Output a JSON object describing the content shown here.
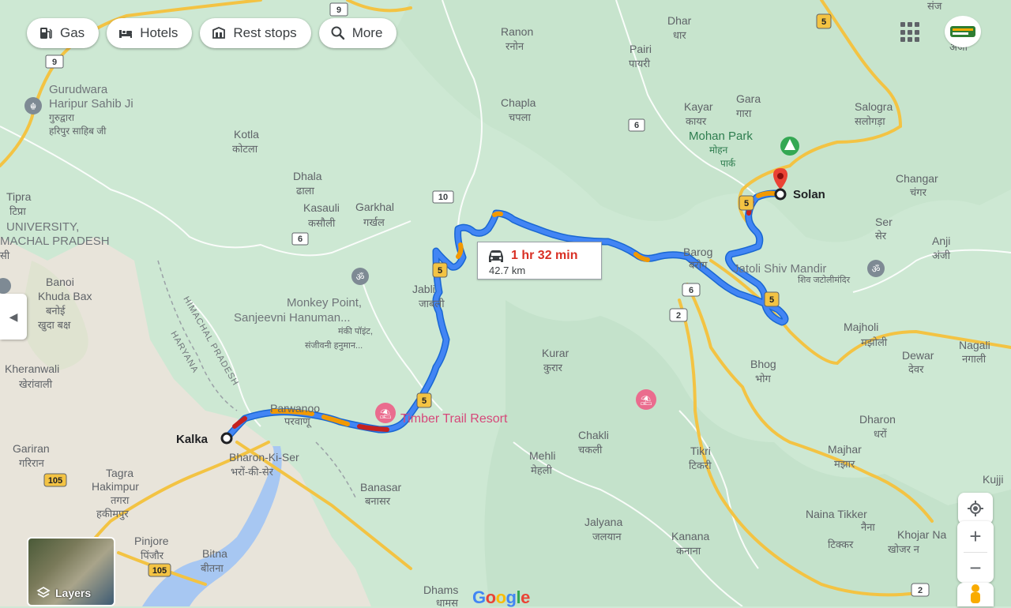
{
  "chips": [
    {
      "label": "Gas",
      "icon": "gas-station-icon"
    },
    {
      "label": "Hotels",
      "icon": "bed-icon"
    },
    {
      "label": "Rest stops",
      "icon": "rest-stop-icon"
    },
    {
      "label": "More",
      "icon": "search-icon"
    }
  ],
  "route": {
    "origin": "Kalka",
    "destination": "Solan",
    "duration": "1 hr 32 min",
    "distance": "42.7 km"
  },
  "map_labels": {
    "tipra": "Tipra",
    "tipra_hi": "टिप्रा",
    "university": "UNIVERSITY,",
    "himachal": "MACHAL PRADESH",
    "himachal_hi": "सी",
    "gurudwara": "Gurudwara",
    "gurudwara2": "Haripur Sahib Ji",
    "gurudwara_hi1": "गुरुद्वारा",
    "gurudwara_hi2": "हरिपुर साहिब जी",
    "kotla": "Kotla",
    "kotla_hi": "कोटला",
    "dhala": "Dhala",
    "dhala_hi": "ढाला",
    "kasauli": "Kasauli",
    "kasauli_hi": "कसौली",
    "garkhal": "Garkhal",
    "garkhal_hi": "गर्खल",
    "banoi": "Banoi",
    "khuda_bax": "Khuda Bax",
    "banoi_hi": "बनोई",
    "khuda_bax_hi": "खुदा बक्ष",
    "monkey1": "Monkey Point,",
    "monkey2": "Sanjeevni Hanuman...",
    "monkey_hi1": "मंकी पॉइंट,",
    "monkey_hi2": "संजीवनी हनुमान...",
    "state_line1": "HIMACHAL PRADESH",
    "state_line2": "HARYANA",
    "kheranwali": "Kheranwali",
    "kheranwali_hi": "खेरांवाली",
    "jabli": "Jabli",
    "jabli_hi": "जाबली",
    "parwanoo": "Parwanoo",
    "parwanoo_hi": "परवाणू",
    "timber_trail": "Timber Trail Resort",
    "kalka": "Kalka",
    "gariran": "Gariran",
    "gariran_hi": "गरिरान",
    "bharon": "Bharon-Ki-Ser",
    "bharon_hi": "भरों-की-सेर",
    "tagra": "Tagra",
    "hakimpur": "Hakimpur",
    "tagra_hi": "तगरा",
    "hakimpur_hi": "हकीमपुर",
    "pinjore": "Pinjore",
    "pinjore_hi": "पिंजौर",
    "bitna": "Bitna",
    "bitna_hi": "बीतना",
    "banasar": "Banasar",
    "banasar_hi": "बनासर",
    "ranon": "Ranon",
    "ranon_hi": "रनोन",
    "dhar": "Dhar",
    "dhar_hi": "धार",
    "pairi": "Pairi",
    "pairi_hi": "पायरी",
    "chapla": "Chapla",
    "chapla_hi": "चपला",
    "kayar": "Kayar",
    "kayar_hi": "कायर",
    "gara": "Gara",
    "gara_hi": "गारा",
    "mohan_park": "Mohan Park",
    "mohan_park_hi1": "मोहन",
    "mohan_park_hi2": "पार्क",
    "salogra": "Salogra",
    "salogra_hi": "सलोगड़ा",
    "changar": "Changar",
    "changar_hi": "चंगर",
    "ser": "Ser",
    "ser_hi": "सेर",
    "anji": "Anji",
    "anji_hi": "अंजी",
    "anji_top": "अंजी",
    "sanj_top": "संज",
    "barog": "Barog",
    "barog_hi": "बरोग",
    "jatoli": "Jatoli Shiv Mandir",
    "jatoli_hi": "शिव जटोलीमंदिर",
    "majholi": "Majholi",
    "majholi_hi": "मझोली",
    "dewar": "Dewar",
    "dewar_hi": "देवर",
    "nagali": "Nagali",
    "nagali_hi": "नगाली",
    "bhog": "Bhog",
    "bhog_hi": "भोग",
    "kurar": "Kurar",
    "kurar_hi": "कुरार",
    "chakli": "Chakli",
    "chakli_hi": "चकली",
    "mehli": "Mehli",
    "mehli_hi": "मेहली",
    "dharon": "Dharon",
    "dharon_hi": "धरों",
    "tikri": "Tikri",
    "tikri_hi": "टिकरी",
    "majhar": "Majhar",
    "majhar_hi": "मझार",
    "kujji": "Kujji",
    "jalyana": "Jalyana",
    "jalyana_hi": "जलयान",
    "kanana": "Kanana",
    "kanana_hi": "कनाना",
    "naina": "Naina Tikker",
    "naina_hi1": "नैना",
    "naina_hi2": "टिक्कर",
    "khojar": "Khojar Na",
    "khojar_hi": "खोजर न",
    "dhams": "Dhams",
    "dhams_hi": "धामस"
  },
  "road_shields": [
    "9",
    "9",
    "5",
    "6",
    "10",
    "6",
    "5",
    "6",
    "2",
    "5",
    "5",
    "5",
    "105",
    "105",
    "2"
  ],
  "layers_label": "Layers",
  "brand": "Google",
  "colors": {
    "route": "#4285f4",
    "traffic_slow": "#f29900",
    "traffic_heavy": "#c5221f",
    "water": "#9cc0f9",
    "forest": "#cfe9d5",
    "urban": "#ece8df",
    "highway": "#f4c042",
    "pin": "#ea4335"
  }
}
